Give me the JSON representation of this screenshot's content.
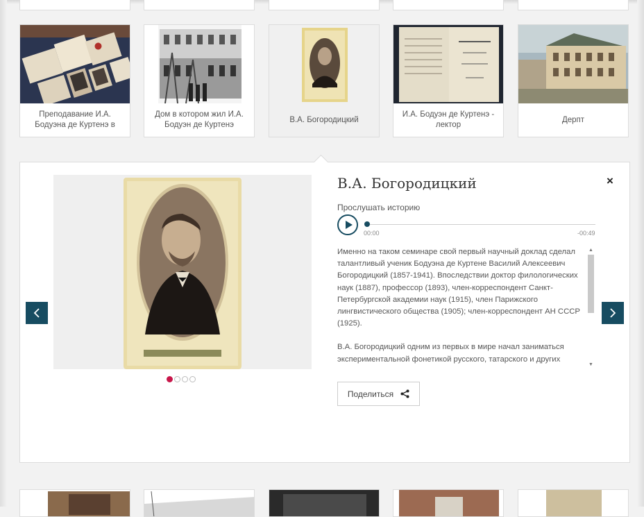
{
  "cards": [
    {
      "caption": "Преподавание И.А. Бодуэна де Куртенэ в"
    },
    {
      "caption": "Дом в котором жил И.А. Бодуэн де Куртенэ"
    },
    {
      "caption": "В.А. Богородицкий"
    },
    {
      "caption": "И.А. Бодуэн де Куртенэ - лектор"
    },
    {
      "caption": "Дерпт"
    }
  ],
  "detail": {
    "title": "В.А. Богородицкий",
    "close_icon": "×",
    "listen_label": "Прослушать историю",
    "time_start": "00:00",
    "time_end": "-00:49",
    "paragraphs": [
      "Именно на таком семинаре свой первый научный доклад сделал талантливый ученик Бодуэна де Куртене Василий Алексеевич Богородицкий (1857-1941). Впоследствии доктор филологических наук (1887), профессор (1893), член-корреспондент Санкт-Петербургской академии наук (1915), член Парижского лингвистического общества (1905); член-корреспондент АН СССР (1925).",
      "В.А. Богородицкий одним из первых в мире начал заниматься экспериментальной фонетикой русского, татарского и других"
    ],
    "share_label": "Поделиться"
  },
  "gallery": {
    "slides_total": 4,
    "active_slide": 1
  },
  "colors": {
    "accent": "#174c61",
    "dot_active": "#c8174a"
  }
}
